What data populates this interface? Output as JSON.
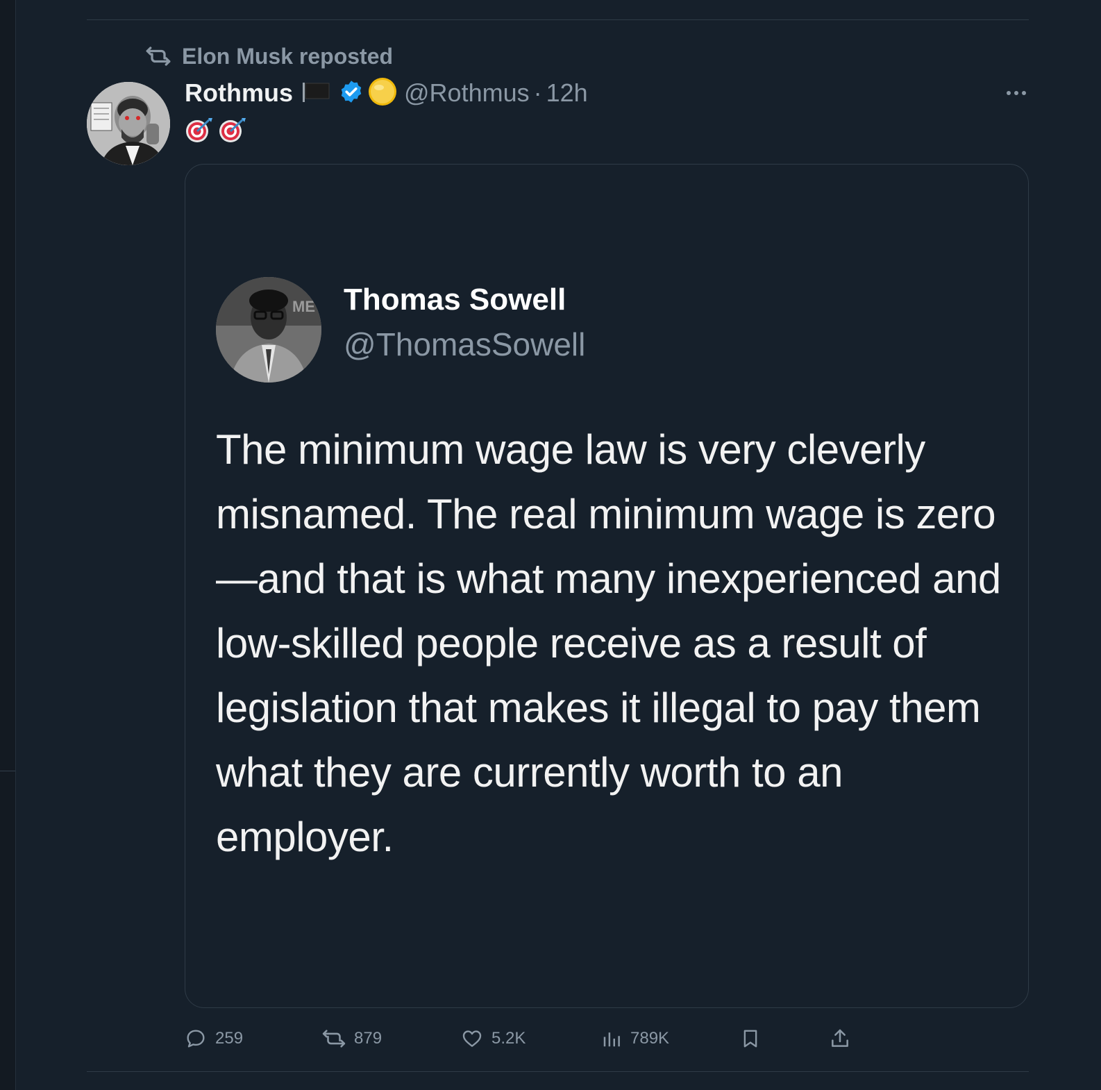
{
  "repost": {
    "label": "Elon Musk reposted"
  },
  "post": {
    "author_name": "Rothmus",
    "handle": "@Rothmus",
    "separator": "·",
    "time": "12h",
    "emoji_text": "🎯🎯",
    "icons": [
      "flag-icon",
      "verified-badge-icon",
      "coin-icon",
      "more-options-icon"
    ]
  },
  "quote_image": {
    "name": "Thomas Sowell",
    "handle": "@ThomasSowell",
    "text": "The minimum wage law is very cleverly misnamed. The real minimum wage is zero—and that is what many inexperienced and low-skilled people receive as a result of legislation that makes it illegal to pay them what they are currently worth to an employer."
  },
  "actions": {
    "replies": "259",
    "reposts": "879",
    "likes": "5.2K",
    "views": "789K"
  },
  "colors": {
    "background": "#16202b",
    "muted_text": "#8b98a5",
    "primary_text": "#e7e9ea",
    "verified_blue": "#1d9bf0",
    "border": "#2f3b47"
  }
}
